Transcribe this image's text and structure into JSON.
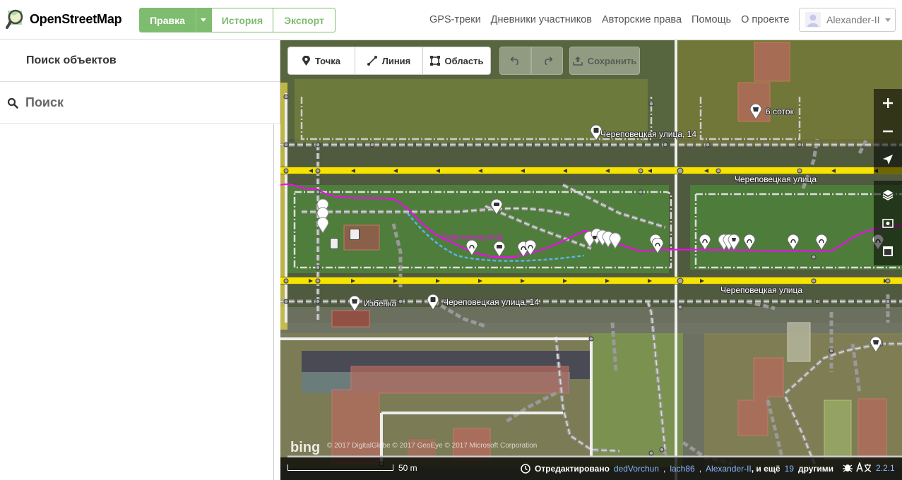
{
  "header": {
    "logo_text": "OpenStreetMap",
    "edit_label": "Правка",
    "history_label": "История",
    "export_label": "Экспорт",
    "nav": [
      "GPS-треки",
      "Дневники участников",
      "Авторские права",
      "Помощь",
      "О проекте"
    ],
    "user_name": "Alexander-II"
  },
  "sidebar": {
    "title": "Поиск объектов",
    "search_placeholder": "Поиск"
  },
  "toolbar": {
    "point_label": "Точка",
    "line_label": "Линия",
    "area_label": "Область",
    "save_label": "Сохранить"
  },
  "map": {
    "street_top_label": "Череповецкая улица",
    "street_bottom_label": "Череповецкая улица",
    "bus_stop_top": "Череповецкая улица, 14",
    "bus_stop_bottom": "Череповецкая улица, 14",
    "shop_izbenka": "Избёнка",
    "shop_6sotok": "6 соток",
    "track_label": "Early evening stroll",
    "bing_logo": "bing",
    "copyright": "© 2017 DigitalGlobe  © 2017 GeoEye  © 2017 Microsoft Corporation"
  },
  "footer": {
    "scale": "50 m",
    "edited_prefix": "Отредактировано",
    "users": [
      "dedVorchun",
      "lach86",
      "Alexander-II"
    ],
    "and_more_prefix": ", и ещё",
    "more_count": "19",
    "more_suffix": "другими",
    "version": "2.2.1"
  },
  "colors": {
    "accent": "#7ebc6f",
    "road_yellow": "#f7e300",
    "track_pink": "#ff00ff",
    "link_blue": "#8bb7ff"
  }
}
